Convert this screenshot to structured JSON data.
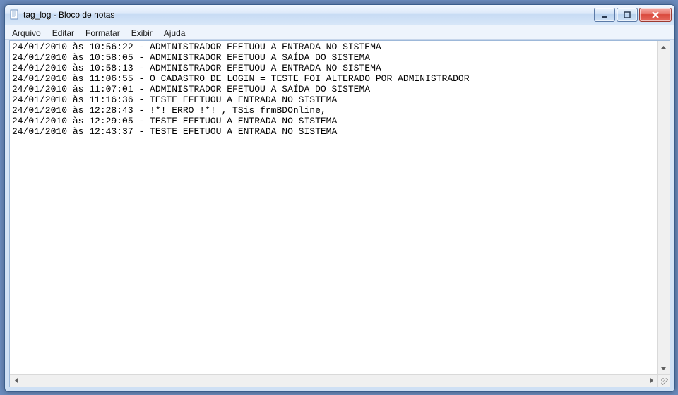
{
  "window": {
    "title": "tag_log - Bloco de notas"
  },
  "menu": {
    "arquivo": "Arquivo",
    "editar": "Editar",
    "formatar": "Formatar",
    "exibir": "Exibir",
    "ajuda": "Ajuda"
  },
  "log_lines": [
    "24/01/2010 às 10:56:22 - ADMINISTRADOR EFETUOU A ENTRADA NO SISTEMA",
    "24/01/2010 às 10:58:05 - ADMINISTRADOR EFETUOU A SAÍDA DO SISTEMA",
    "24/01/2010 às 10:58:13 - ADMINISTRADOR EFETUOU A ENTRADA NO SISTEMA",
    "24/01/2010 às 11:06:55 - O CADASTRO DE LOGIN = TESTE FOI ALTERADO POR ADMINISTRADOR",
    "24/01/2010 às 11:07:01 - ADMINISTRADOR EFETUOU A SAÍDA DO SISTEMA",
    "24/01/2010 às 11:16:36 - TESTE EFETUOU A ENTRADA NO SISTEMA",
    "24/01/2010 às 12:28:43 - !*! ERRO !*! , TSis_frmBDOnline,",
    "24/01/2010 às 12:29:05 - TESTE EFETUOU A ENTRADA NO SISTEMA",
    "24/01/2010 às 12:43:37 - TESTE EFETUOU A ENTRADA NO SISTEMA"
  ]
}
